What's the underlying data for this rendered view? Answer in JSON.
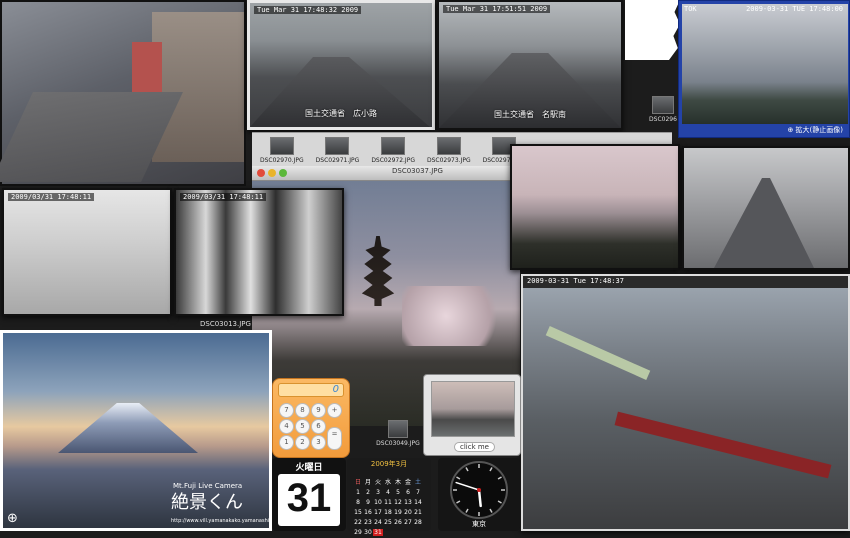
{
  "traffic_cam_1": {
    "timestamp": "Tue Mar 31 17:48:32 2009",
    "caption": "国土交通省　広小路"
  },
  "traffic_cam_2": {
    "timestamp": "Tue Mar 31 17:51:51 2009",
    "caption": "国土交通省　名駅南"
  },
  "sky_cam": {
    "timestamp": "2009-03-31 TUE 17:48:00",
    "corner_label": "TOK",
    "zoom_label": "⊕ 拡大(静止画像)"
  },
  "street_cam_1": {
    "timestamp": "2009/03/31 17:48:11"
  },
  "street_cam_2": {
    "timestamp": "2009/03/31 17:48:11"
  },
  "rail_cam": {
    "timestamp": "2009-03-31 Tue  17:48:37"
  },
  "photo_browser": {
    "title": "DSC03037.JPG",
    "thumbnails": [
      "DSC02970.JPG",
      "DSC02971.JPG",
      "DSC02972.JPG",
      "DSC02973.JPG",
      "DSC02974.JPG"
    ],
    "side_thumb": "DSC0296",
    "lower_labels": [
      "DSC03013.JPG",
      "DSC03049.JPG"
    ]
  },
  "fuji_cam": {
    "title_small": "Mt.Fuji Live Camera",
    "title_large": "絶景くん",
    "url": "http://www.vill.yamanakako.yamanashi.jp/",
    "zoom_symbol": "⊕"
  },
  "calculator": {
    "display": "0",
    "keys": [
      "mc",
      "m+",
      "m-",
      "mr",
      "C",
      "÷",
      "×",
      "−",
      "7",
      "8",
      "9",
      "+",
      "4",
      "5",
      "6",
      "1",
      "2",
      "3",
      "=",
      "0",
      "."
    ]
  },
  "date_widget": {
    "weekday": "火曜日",
    "day": "31"
  },
  "calendar_widget": {
    "month_label": "2009年3月",
    "weekday_headers": [
      "日",
      "月",
      "火",
      "水",
      "木",
      "金",
      "土"
    ],
    "weeks": [
      [
        "1",
        "2",
        "3",
        "4",
        "5",
        "6",
        "7"
      ],
      [
        "8",
        "9",
        "10",
        "11",
        "12",
        "13",
        "14"
      ],
      [
        "15",
        "16",
        "17",
        "18",
        "19",
        "20",
        "21"
      ],
      [
        "22",
        "23",
        "24",
        "25",
        "26",
        "27",
        "28"
      ],
      [
        "29",
        "30",
        "31",
        "",
        "",
        "",
        ""
      ]
    ]
  },
  "clock_widget": {
    "city": "東京",
    "hour": 5,
    "minute": 48
  },
  "photo_widget": {
    "button_label": "click me"
  },
  "colors": {
    "calc_orange": "#f7a64a",
    "calc_display": "#ffd38a",
    "accent_red": "#d02020"
  }
}
